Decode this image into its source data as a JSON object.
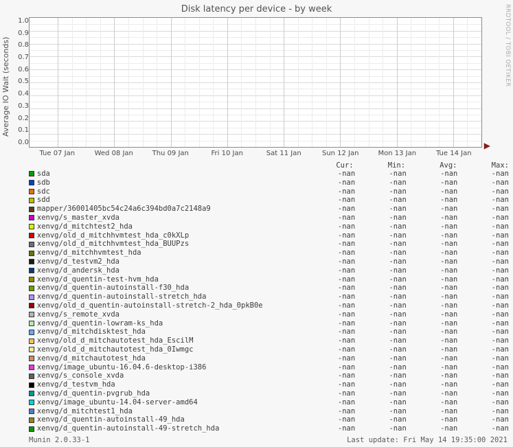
{
  "title": "Disk latency per device - by week",
  "ylabel": "Average IO Wait (seconds)",
  "sidelabel": "RRDTOOL / TOBI OETIKER",
  "chart_data": {
    "type": "line",
    "title": "Disk latency per device - by week",
    "xlabel": "",
    "ylabel": "Average IO Wait (seconds)",
    "ylim": [
      0.0,
      1.0
    ],
    "yticks": [
      "1.0",
      "0.9",
      "0.8",
      "0.7",
      "0.6",
      "0.5",
      "0.4",
      "0.3",
      "0.2",
      "0.1",
      "0.0"
    ],
    "xticks": [
      "Tue 07 Jan",
      "Wed 08 Jan",
      "Thu 09 Jan",
      "Fri 10 Jan",
      "Sat 11 Jan",
      "Sun 12 Jan",
      "Mon 13 Jan",
      "Tue 14 Jan"
    ],
    "series": []
  },
  "columns": {
    "cur": "Cur:",
    "min": "Min:",
    "avg": "Avg:",
    "max": "Max:"
  },
  "legend": [
    {
      "color": "#00a000",
      "name": "sda",
      "cur": "-nan",
      "min": "-nan",
      "avg": "-nan",
      "max": "-nan"
    },
    {
      "color": "#0044c8",
      "name": "sdb",
      "cur": "-nan",
      "min": "-nan",
      "avg": "-nan",
      "max": "-nan"
    },
    {
      "color": "#e87000",
      "name": "sdc",
      "cur": "-nan",
      "min": "-nan",
      "avg": "-nan",
      "max": "-nan"
    },
    {
      "color": "#c0c000",
      "name": "sdd",
      "cur": "-nan",
      "min": "-nan",
      "avg": "-nan",
      "max": "-nan"
    },
    {
      "color": "#5a3d1e",
      "name": "mapper/36001405bc54c24a6c394bd0a7c2148a9",
      "cur": "-nan",
      "min": "-nan",
      "avg": "-nan",
      "max": "-nan"
    },
    {
      "color": "#c800c8",
      "name": "xenvg/s_master_xvda",
      "cur": "-nan",
      "min": "-nan",
      "avg": "-nan",
      "max": "-nan"
    },
    {
      "color": "#dbff00",
      "name": "xenvg/d_mitchtest2_hda",
      "cur": "-nan",
      "min": "-nan",
      "avg": "-nan",
      "max": "-nan"
    },
    {
      "color": "#d20000",
      "name": "xenvg/old_d_mitchhvmtest_hda_c0kXLp",
      "cur": "-nan",
      "min": "-nan",
      "avg": "-nan",
      "max": "-nan"
    },
    {
      "color": "#6f6f6f",
      "name": "xenvg/old_d_mitchhvmtest_hda_BUUPzs",
      "cur": "-nan",
      "min": "-nan",
      "avg": "-nan",
      "max": "-nan"
    },
    {
      "color": "#5f7c00",
      "name": "xenvg/d_mitchhvmtest_hda",
      "cur": "-nan",
      "min": "-nan",
      "avg": "-nan",
      "max": "-nan"
    },
    {
      "color": "#1a1a1a",
      "name": "xenvg/d_testvm2_hda",
      "cur": "-nan",
      "min": "-nan",
      "avg": "-nan",
      "max": "-nan"
    },
    {
      "color": "#003d82",
      "name": "xenvg/d_andersk_hda",
      "cur": "-nan",
      "min": "-nan",
      "avg": "-nan",
      "max": "-nan"
    },
    {
      "color": "#8c8c00",
      "name": "xenvg/d_quentin-test-hvm_hda",
      "cur": "-nan",
      "min": "-nan",
      "avg": "-nan",
      "max": "-nan"
    },
    {
      "color": "#74a000",
      "name": "xenvg/d_quentin-autoinstall-f30_hda",
      "cur": "-nan",
      "min": "-nan",
      "avg": "-nan",
      "max": "-nan"
    },
    {
      "color": "#b38cff",
      "name": "xenvg/d_quentin-autoinstall-stretch_hda",
      "cur": "-nan",
      "min": "-nan",
      "avg": "-nan",
      "max": "-nan"
    },
    {
      "color": "#960000",
      "name": "xenvg/old_d_quentin-autoinstall-stretch-2_hda_0pkB0e",
      "cur": "-nan",
      "min": "-nan",
      "avg": "-nan",
      "max": "-nan"
    },
    {
      "color": "#b4b4b4",
      "name": "xenvg/s_remote_xvda",
      "cur": "-nan",
      "min": "-nan",
      "avg": "-nan",
      "max": "-nan"
    },
    {
      "color": "#b0e8b0",
      "name": "xenvg/d_quentin-lowram-ks_hda",
      "cur": "-nan",
      "min": "-nan",
      "avg": "-nan",
      "max": "-nan"
    },
    {
      "color": "#6aa6ff",
      "name": "xenvg/d_mitchdisktest_hda",
      "cur": "-nan",
      "min": "-nan",
      "avg": "-nan",
      "max": "-nan"
    },
    {
      "color": "#ffc060",
      "name": "xenvg/old_d_mitchautotest_hda_EscilM",
      "cur": "-nan",
      "min": "-nan",
      "avg": "-nan",
      "max": "-nan"
    },
    {
      "color": "#ffe89a",
      "name": "xenvg/old_d_mitchautotest_hda_0Iwmgc",
      "cur": "-nan",
      "min": "-nan",
      "avg": "-nan",
      "max": "-nan"
    },
    {
      "color": "#c89060",
      "name": "xenvg/d_mitchautotest_hda",
      "cur": "-nan",
      "min": "-nan",
      "avg": "-nan",
      "max": "-nan"
    },
    {
      "color": "#ff30d8",
      "name": "xenvg/image_ubuntu-16.04.6-desktop-i386",
      "cur": "-nan",
      "min": "-nan",
      "avg": "-nan",
      "max": "-nan"
    },
    {
      "color": "#606060",
      "name": "xenvg/s_console_xvda",
      "cur": "-nan",
      "min": "-nan",
      "avg": "-nan",
      "max": "-nan"
    },
    {
      "color": "#000000",
      "name": "xenvg/d_testvm_hda",
      "cur": "-nan",
      "min": "-nan",
      "avg": "-nan",
      "max": "-nan"
    },
    {
      "color": "#009898",
      "name": "xenvg/d_quentin-pvgrub_hda",
      "cur": "-nan",
      "min": "-nan",
      "avg": "-nan",
      "max": "-nan"
    },
    {
      "color": "#00d4d4",
      "name": "xenvg/image_ubuntu-14.04-server-amd64",
      "cur": "-nan",
      "min": "-nan",
      "avg": "-nan",
      "max": "-nan"
    },
    {
      "color": "#5080c0",
      "name": "xenvg/d_mitchtest1_hda",
      "cur": "-nan",
      "min": "-nan",
      "avg": "-nan",
      "max": "-nan"
    },
    {
      "color": "#8a8a20",
      "name": "xenvg/d_quentin-autoinstall-49_hda",
      "cur": "-nan",
      "min": "-nan",
      "avg": "-nan",
      "max": "-nan"
    },
    {
      "color": "#009a00",
      "name": "xenvg/d_quentin-autoinstall-49-stretch_hda",
      "cur": "-nan",
      "min": "-nan",
      "avg": "-nan",
      "max": "-nan"
    }
  ],
  "footer": {
    "version": "Munin 2.0.33-1",
    "updated": "Last update: Fri May 14 19:35:00 2021"
  }
}
